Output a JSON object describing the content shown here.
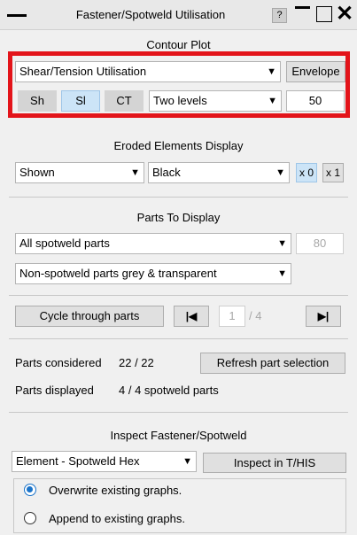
{
  "window": {
    "title": "Fastener/Spotweld Utilisation",
    "help_label": "?"
  },
  "contour": {
    "section_title": "Contour Plot",
    "type_value": "Shear/Tension Utilisation",
    "envelope_label": "Envelope",
    "btn_sh": "Sh",
    "btn_sl": "Sl",
    "btn_ct": "CT",
    "levels_value": "Two levels",
    "levels_count": "50"
  },
  "eroded": {
    "section_title": "Eroded Elements Display",
    "display_value": "Shown",
    "color_value": "Black",
    "x0_label": "x 0",
    "x1_label": "x 1"
  },
  "parts": {
    "section_title": "Parts To Display",
    "filter_value": "All spotweld parts",
    "count_value": "80",
    "nonspot_value": "Non-spotweld parts grey & transparent",
    "cycle_label": "Cycle through parts",
    "page_current": "1",
    "page_total": "/ 4"
  },
  "summary": {
    "considered_label": "Parts considered",
    "considered_value": "22 / 22",
    "refresh_label": "Refresh part selection",
    "displayed_label": "Parts displayed",
    "displayed_value": "4 / 4 spotweld parts"
  },
  "inspect": {
    "section_title": "Inspect Fastener/Spotweld",
    "element_value": "Element - Spotweld Hex",
    "inspect_label": "Inspect in T/HIS",
    "radio_overwrite": "Overwrite existing graphs.",
    "radio_append": "Append to existing graphs.",
    "selected": "overwrite"
  },
  "colors": {
    "highlight": "#e3141a",
    "accent_blue": "#cce4f7",
    "radio_blue": "#1a73c9"
  }
}
